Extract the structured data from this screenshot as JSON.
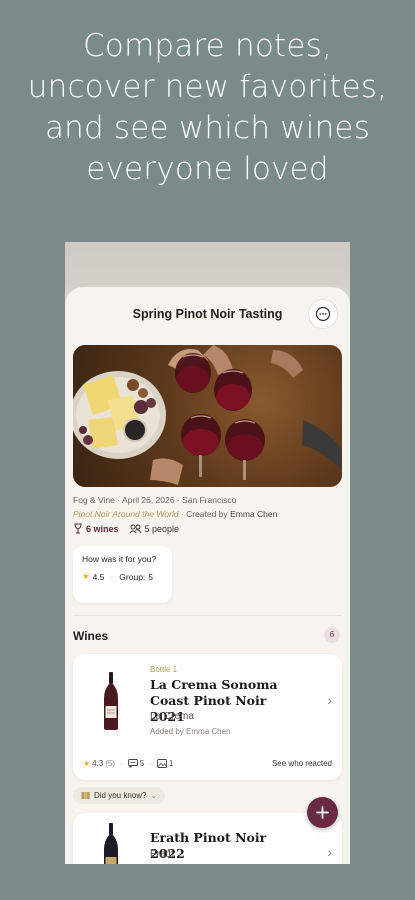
{
  "marketing": {
    "headline_line1": "Compare notes,",
    "headline_line2": "uncover new favorites,",
    "headline_line3": "and see which wines",
    "headline_line4": "everyone loved"
  },
  "event": {
    "title": "Spring Pinot Noir Tasting",
    "more_icon": "ellipsis-icon",
    "venue": "Fog & Vine",
    "date": "April 26, 2026",
    "city": "San Francisco",
    "collection": "Pinot Noir Around the World",
    "created_by_prefix": "Created by",
    "creator": "Emma Chen",
    "wines_stat": "6 wines",
    "people_stat": "5 people"
  },
  "rating_card": {
    "question": "How was it for you?",
    "my_rating": "4.5",
    "group_label": "Group:",
    "group_rating": "5"
  },
  "wines_section": {
    "heading": "Wines",
    "count": "6",
    "items": [
      {
        "label": "Bottle 1",
        "name": "La Crema Sonoma Coast Pinot Noir 2021",
        "producer": "La Crema",
        "added_by": "Added by Emma Chen",
        "rating": "4.3",
        "rating_count": "(5)",
        "comments": "5",
        "photos": "1",
        "reactions_link": "See who reacted"
      },
      {
        "name": "Erath Pinot Noir 2022",
        "producer": "Erath"
      }
    ],
    "did_you_know": "Did you know?"
  },
  "fab": {
    "icon": "plus-icon"
  },
  "colors": {
    "background": "#7a8b89",
    "accent_wine": "#6b2a44",
    "gold": "#b59a57",
    "star": "#e7b321",
    "sheet": "#f7f4f0"
  }
}
